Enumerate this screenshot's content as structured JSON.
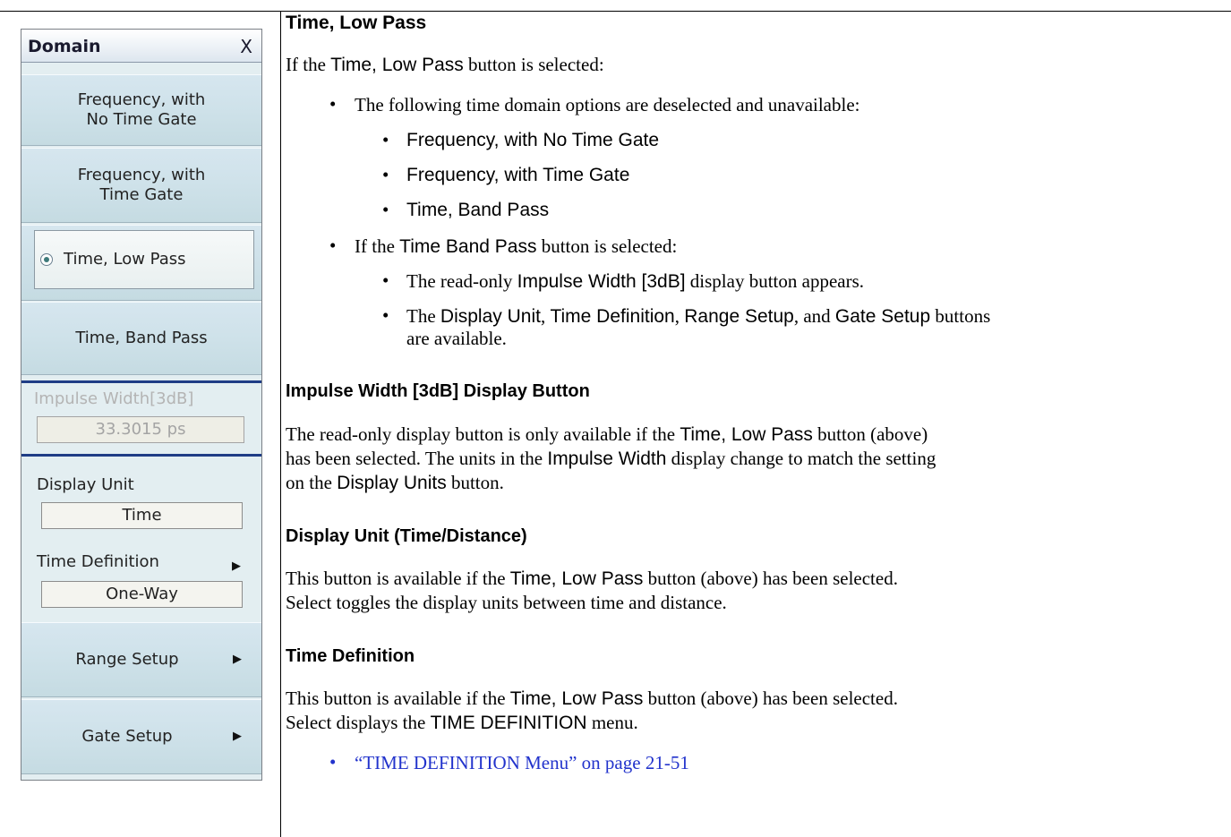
{
  "menu": {
    "title": "Domain",
    "close_label": "X",
    "buttons": {
      "freq_no_gate": [
        "Frequency, with",
        "No Time Gate"
      ],
      "freq_gate": [
        "Frequency, with",
        "Time Gate"
      ],
      "time_low_pass": "Time, Low Pass",
      "time_band_pass": "Time, Band Pass",
      "range_setup": "Range Setup",
      "gate_setup": "Gate Setup"
    },
    "impulse_width": {
      "label": "Impulse Width[3dB]",
      "value": "33.3015 ps"
    },
    "display_unit": {
      "label": "Display Unit",
      "value": "Time"
    },
    "time_definition": {
      "label": "Time Definition",
      "value": "One-Way"
    }
  },
  "doc": {
    "s1": {
      "heading": "Time, Low Pass",
      "intro": [
        "If the ",
        "Time, Low Pass",
        " button is selected:"
      ],
      "b1": "The following time domain options are deselected and unavailable:",
      "b1_items": [
        "Frequency, with No Time Gate",
        "Frequency, with Time Gate",
        "Time, Band Pass"
      ],
      "b2": [
        "If the ",
        "Time Band Pass",
        " button is selected:"
      ],
      "b2_item1": [
        "The read-only ",
        "Impulse Width [3dB]",
        " display button appears."
      ],
      "b2_item2": [
        "The ",
        "Display Unit",
        ", ",
        "Time Definition",
        ", ",
        "Range Setup",
        ", and ",
        "Gate Setup",
        " buttons"
      ],
      "b2_item2_cont": "are available."
    },
    "s2": {
      "heading": "Impulse Width [3dB] Display Button",
      "line1": [
        "The read-only display button is only available if the ",
        "Time, Low Pass",
        " button (above)"
      ],
      "line2": [
        "has been selected. The units in the ",
        "Impulse Width",
        " display change to match the setting"
      ],
      "line3": [
        "on the ",
        "Display Units",
        " button."
      ]
    },
    "s3": {
      "heading": "Display Unit (Time/Distance)",
      "line1": [
        "This button is available if the ",
        "Time, Low Pass",
        " button (above) has been selected."
      ],
      "line2": "Select toggles the display units between time and distance."
    },
    "s4": {
      "heading": "Time Definition",
      "line1": [
        "This button is available if the ",
        "Time, Low Pass",
        " button (above) has been selected."
      ],
      "line2": [
        "Select displays the ",
        "TIME DEFINITION",
        " menu."
      ],
      "link": "“TIME DEFINITION Menu” on page 21-51"
    },
    "bullet_char": "•",
    "link_color": "#2233cc"
  }
}
